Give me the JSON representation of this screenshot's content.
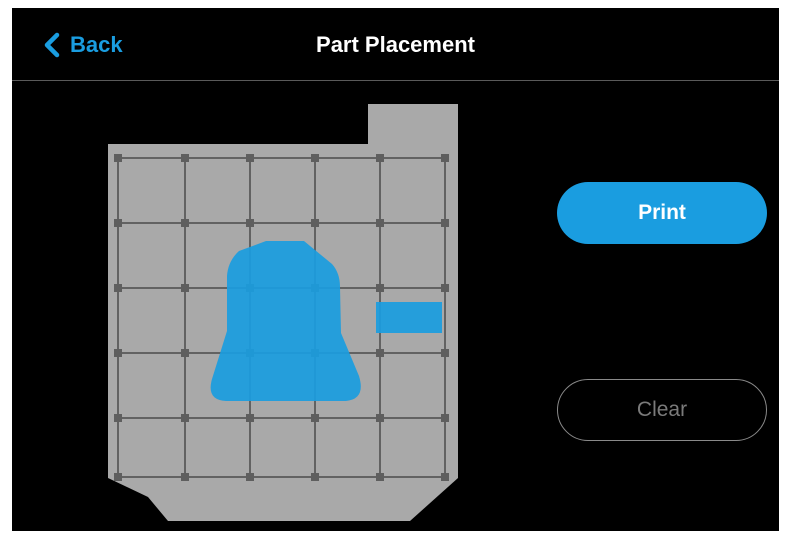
{
  "header": {
    "back_label": "Back",
    "title": "Part Placement"
  },
  "actions": {
    "print_label": "Print",
    "clear_label": "Clear"
  },
  "icons": {
    "back": "chevron-left-icon"
  },
  "colors": {
    "accent": "#1a9de0",
    "background": "#000000",
    "plate": "#a9a9a9",
    "grid_line": "#4a4a4a",
    "part": "#1a9de0",
    "disabled_text": "#7a7a7a"
  },
  "build_plate": {
    "grid_columns": 5,
    "grid_rows": 5,
    "parts": [
      "part-large",
      "part-small"
    ]
  }
}
